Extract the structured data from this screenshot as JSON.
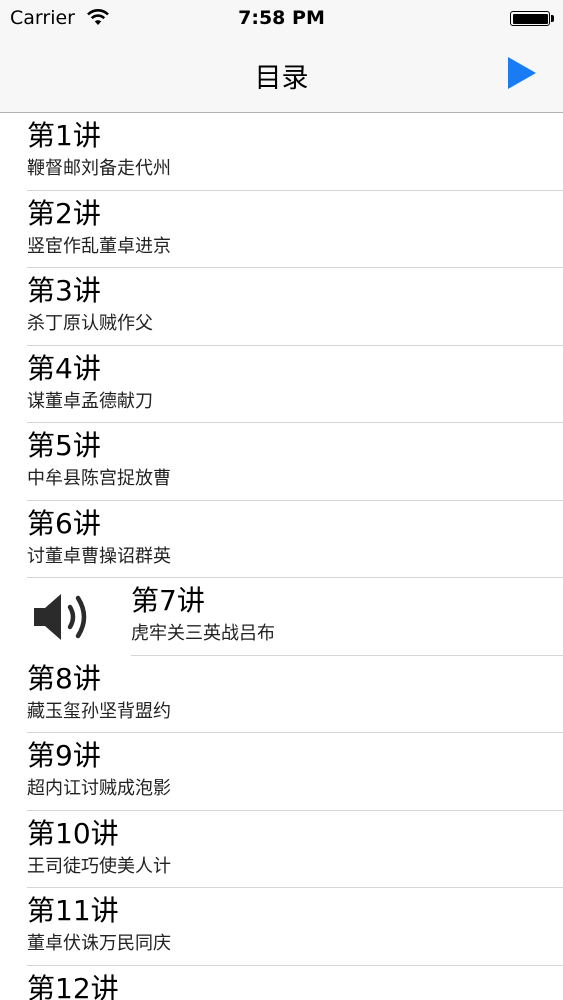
{
  "status": {
    "carrier": "Carrier",
    "time": "7:58 PM"
  },
  "nav": {
    "title": "目录",
    "play_icon": "play-icon",
    "accent": "#1a7cf5"
  },
  "playing_index": 6,
  "items": [
    {
      "title": "第1讲",
      "subtitle": "鞭督邮刘备走代州"
    },
    {
      "title": "第2讲",
      "subtitle": "竖宦作乱董卓进京"
    },
    {
      "title": "第3讲",
      "subtitle": "杀丁原认贼作父"
    },
    {
      "title": "第4讲",
      "subtitle": "谋董卓孟德献刀"
    },
    {
      "title": "第5讲",
      "subtitle": "中牟县陈宫捉放曹"
    },
    {
      "title": "第6讲",
      "subtitle": "讨董卓曹操诏群英"
    },
    {
      "title": "第7讲",
      "subtitle": "虎牢关三英战吕布"
    },
    {
      "title": "第8讲",
      "subtitle": "藏玉玺孙坚背盟约"
    },
    {
      "title": "第9讲",
      "subtitle": "超内讧讨贼成泡影"
    },
    {
      "title": "第10讲",
      "subtitle": "王司徒巧使美人计"
    },
    {
      "title": "第11讲",
      "subtitle": "董卓伏诛万民同庆"
    },
    {
      "title": "第12讲",
      "subtitle": ""
    }
  ]
}
